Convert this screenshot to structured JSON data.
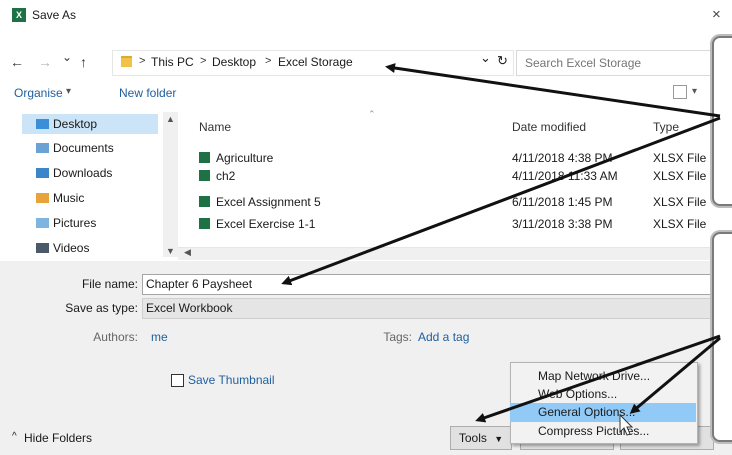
{
  "window": {
    "title": "Save As",
    "close": "×"
  },
  "nav": {
    "back": "←",
    "forward": "→",
    "recent": "⌄",
    "up": "↑"
  },
  "address": {
    "crumbs": [
      "This PC",
      "Desktop",
      "Excel Storage"
    ],
    "dropdown": "⌄",
    "refresh": "↻"
  },
  "search": {
    "placeholder": "Search Excel Storage"
  },
  "toolbar": {
    "organise": "Organise",
    "new_folder": "New folder"
  },
  "sidebar": {
    "items": [
      {
        "label": "Desktop",
        "color": "#3b8fd9"
      },
      {
        "label": "Documents",
        "color": "#6aa2d6"
      },
      {
        "label": "Downloads",
        "color": "#3a86c8"
      },
      {
        "label": "Music",
        "color": "#e8a33a"
      },
      {
        "label": "Pictures",
        "color": "#7fb3e0"
      },
      {
        "label": "Videos",
        "color": "#4b5a6b"
      }
    ]
  },
  "columns": {
    "name": "Name",
    "date": "Date modified",
    "type": "Type"
  },
  "files": [
    {
      "name": "Agriculture",
      "date": "4/11/2018 4:38 PM",
      "type": "XLSX File"
    },
    {
      "name": "ch2",
      "date": "4/11/2018 11:33 AM",
      "type": "XLSX File"
    },
    {
      "name": "Excel Assignment 5",
      "date": "6/11/2018 1:45 PM",
      "type": "XLSX File"
    },
    {
      "name": "Excel Exercise 1-1",
      "date": "3/11/2018 3:38 PM",
      "type": "XLSX File"
    }
  ],
  "form": {
    "file_name_label": "File name:",
    "file_name": "Chapter 6 Paysheet",
    "save_type_label": "Save as type:",
    "save_type": "Excel Workbook",
    "authors_label": "Authors:",
    "authors": "me",
    "tags_label": "Tags:",
    "tags": "Add a tag",
    "thumbnail": "Save Thumbnail"
  },
  "footer": {
    "hide_folders": "Hide Folders",
    "tools": "Tools"
  },
  "tools_menu": {
    "items": [
      "Map Network Drive...",
      "Web Options...",
      "General Options...",
      "Compress Pictures..."
    ],
    "highlighted": "General Options..."
  },
  "colors": {
    "accent": "#1f5f9e",
    "selection": "#cce4f7",
    "menu_highlight": "#91c9f7",
    "excel_green": "#1e7145"
  }
}
